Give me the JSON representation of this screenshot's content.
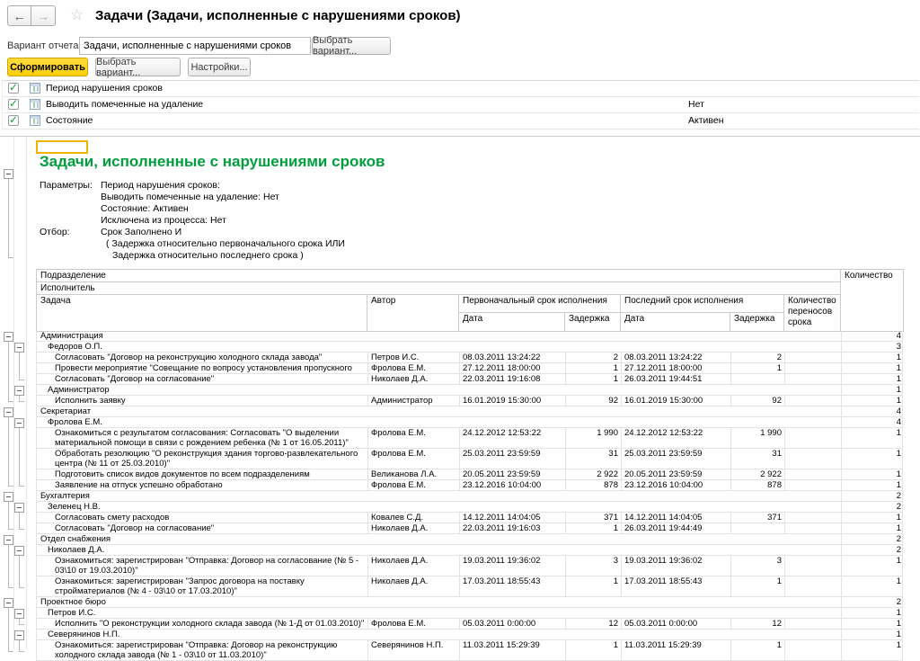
{
  "colors": {
    "accent_green": "#009e3d",
    "generate_yellow": "#ffd21e",
    "check_green": "#18a23c"
  },
  "toolbar": {
    "title": "Задачи (Задачи, исполненные с нарушениями сроков)",
    "back_icon": "←",
    "forward_icon": "→",
    "star_icon": "☆"
  },
  "variant": {
    "label": "Вариант отчета:",
    "value": "Задачи, исполненные с нарушениями сроков",
    "choose_button": "Выбрать вариант..."
  },
  "actions": {
    "generate": "Сформировать",
    "choose_variant": "Выбрать вариант...",
    "settings": "Настройки..."
  },
  "filters": [
    {
      "label": "Период нарушения сроков",
      "value": ""
    },
    {
      "label": "Выводить помеченные на удаление",
      "value": "Нет"
    },
    {
      "label": "Состояние",
      "value": "Активен"
    }
  ],
  "report": {
    "title": "Задачи, исполненные с нарушениями сроков",
    "params_label": "Параметры:",
    "params": [
      "Период нарушения сроков:",
      "Выводить помеченные на удаление: Нет",
      "Состояние: Активен",
      "Исключена из процесса: Нет"
    ],
    "filter_label": "Отбор:",
    "filter_lines": [
      "Срок Заполнено И",
      "( Задержка относительно первоначального срока ИЛИ",
      "Задержка относительно последнего срока )"
    ],
    "columns": {
      "podrazdelenie": "Подразделение",
      "ispolnitel": "Исполнитель",
      "zadacha": "Задача",
      "avtor": "Автор",
      "first_term": "Первоначальный срок исполнения",
      "last_term": "Последний срок исполнения",
      "date": "Дата",
      "delay": "Задержка",
      "perenosy": "Количество переносов срока",
      "kolichestvo": "Количество"
    },
    "rows": [
      {
        "g": 1,
        "text": "Администрация",
        "cnt": "4"
      },
      {
        "g": 2,
        "text": "Федоров О.П.",
        "cnt": "3"
      },
      {
        "lines": 1,
        "text": "Согласовать \"Договор на реконструкцию холодного склада завода\"",
        "author": "Петров И.С.",
        "d1": "08.03.2011 13:24:22",
        "z1": "2",
        "d2": "08.03.2011 13:24:22",
        "z2": "2",
        "mv": "",
        "cnt": "1"
      },
      {
        "lines": 1,
        "text": "Провести мероприятие \"Совещание по вопросу установления пропускного режима\"",
        "author": "Фролова Е.М.",
        "d1": "27.12.2011 18:00:00",
        "z1": "1",
        "d2": "27.12.2011 18:00:00",
        "z2": "1",
        "mv": "",
        "cnt": "1"
      },
      {
        "lines": 1,
        "text": "Согласовать \"Договор на согласование\"",
        "author": "Николаев Д.А.",
        "d1": "22.03.2011 19:16:08",
        "z1": "1",
        "d2": "26.03.2011 19:44:51",
        "z2": "",
        "mv": "",
        "cnt": "1"
      },
      {
        "g": 2,
        "text": "Администратор",
        "cnt": "1"
      },
      {
        "lines": 1,
        "text": "Исполнить заявку",
        "author": "Администратор",
        "d1": "16.01.2019 15:30:00",
        "z1": "92",
        "d2": "16.01.2019 15:30:00",
        "z2": "92",
        "mv": "",
        "cnt": "1"
      },
      {
        "g": 1,
        "text": "Секретариат",
        "cnt": "4"
      },
      {
        "g": 2,
        "text": "Фролова Е.М.",
        "cnt": "4"
      },
      {
        "lines": 2,
        "text": "Ознакомиться с результатом согласования: Согласовать \"О выделении материальной помощи в связи с рождением ребенка (№ 1 от 16.05.2011)\"",
        "author": "Фролова Е.М.",
        "d1": "24.12.2012 12:53:22",
        "z1": "1 990",
        "d2": "24.12.2012 12:53:22",
        "z2": "1 990",
        "mv": "",
        "cnt": "1"
      },
      {
        "lines": 2,
        "text": "Обработать резолюцию \"О реконструкция здания торгово-развлекательного центра (№ 11 от 25.03.2010)\"",
        "author": "Фролова Е.М.",
        "d1": "25.03.2011 23:59:59",
        "z1": "31",
        "d2": "25.03.2011 23:59:59",
        "z2": "31",
        "mv": "",
        "cnt": "1"
      },
      {
        "lines": 1,
        "text": "Подготовить список видов документов по всем подразделениям",
        "author": "Великанова Л.А.",
        "d1": "20.05.2011 23:59:59",
        "z1": "2 922",
        "d2": "20.05.2011 23:59:59",
        "z2": "2 922",
        "mv": "",
        "cnt": "1"
      },
      {
        "lines": 1,
        "text": "Заявление на отпуск успешно обработано",
        "author": "Фролова Е.М.",
        "d1": "23.12.2016 10:04:00",
        "z1": "878",
        "d2": "23.12.2016 10:04:00",
        "z2": "878",
        "mv": "",
        "cnt": "1"
      },
      {
        "g": 1,
        "text": "Бухгалтерия",
        "cnt": "2"
      },
      {
        "g": 2,
        "text": "Зеленец Н.В.",
        "cnt": "2"
      },
      {
        "lines": 1,
        "text": "Согласовать смету расходов",
        "author": "Ковалев С.Д.",
        "d1": "14.12.2011 14:04:05",
        "z1": "371",
        "d2": "14.12.2011 14:04:05",
        "z2": "371",
        "mv": "",
        "cnt": "1"
      },
      {
        "lines": 1,
        "text": "Согласовать \"Договор на согласование\"",
        "author": "Николаев Д.А.",
        "d1": "22.03.2011 19:16:03",
        "z1": "1",
        "d2": "26.03.2011 19:44:49",
        "z2": "",
        "mv": "",
        "cnt": "1"
      },
      {
        "g": 1,
        "text": "Отдел снабжения",
        "cnt": "2"
      },
      {
        "g": 2,
        "text": "Николаев Д.А.",
        "cnt": "2"
      },
      {
        "lines": 2,
        "text": "Ознакомиться: зарегистрирован \"Отправка: Договор на согласование (№ 5 - 03\\10 от 19.03.2010)\"",
        "author": "Николаев Д.А.",
        "d1": "19.03.2011 19:36:02",
        "z1": "3",
        "d2": "19.03.2011 19:36:02",
        "z2": "3",
        "mv": "",
        "cnt": "1"
      },
      {
        "lines": 2,
        "text": "Ознакомиться: зарегистрирован \"Запрос договора на поставку стройматериалов (№ 4 - 03\\10 от 17.03.2010)\"",
        "author": "Николаев Д.А.",
        "d1": "17.03.2011 18:55:43",
        "z1": "1",
        "d2": "17.03.2011 18:55:43",
        "z2": "1",
        "mv": "",
        "cnt": "1"
      },
      {
        "g": 1,
        "text": "Проектное бюро",
        "cnt": "2"
      },
      {
        "g": 2,
        "text": "Петров И.С.",
        "cnt": "1"
      },
      {
        "lines": 1,
        "text": "Исполнить \"О реконструкции холодного склада завода (№ 1-Д от 01.03.2010)\"",
        "author": "Фролова Е.М.",
        "d1": "05.03.2011 0:00:00",
        "z1": "12",
        "d2": "05.03.2011 0:00:00",
        "z2": "12",
        "mv": "",
        "cnt": "1"
      },
      {
        "g": 2,
        "text": "Северянинов Н.П.",
        "cnt": "1"
      },
      {
        "lines": 2,
        "text": "Ознакомиться: зарегистрирован \"Отправка: Договор на реконструкцию холодного склада завода (№ 1 - 03\\10 от 11.03.2010)\"",
        "author": "Северянинов Н.П.",
        "d1": "11.03.2011 15:29:39",
        "z1": "1",
        "d2": "11.03.2011 15:29:39",
        "z2": "1",
        "mv": "",
        "cnt": "1"
      }
    ]
  }
}
